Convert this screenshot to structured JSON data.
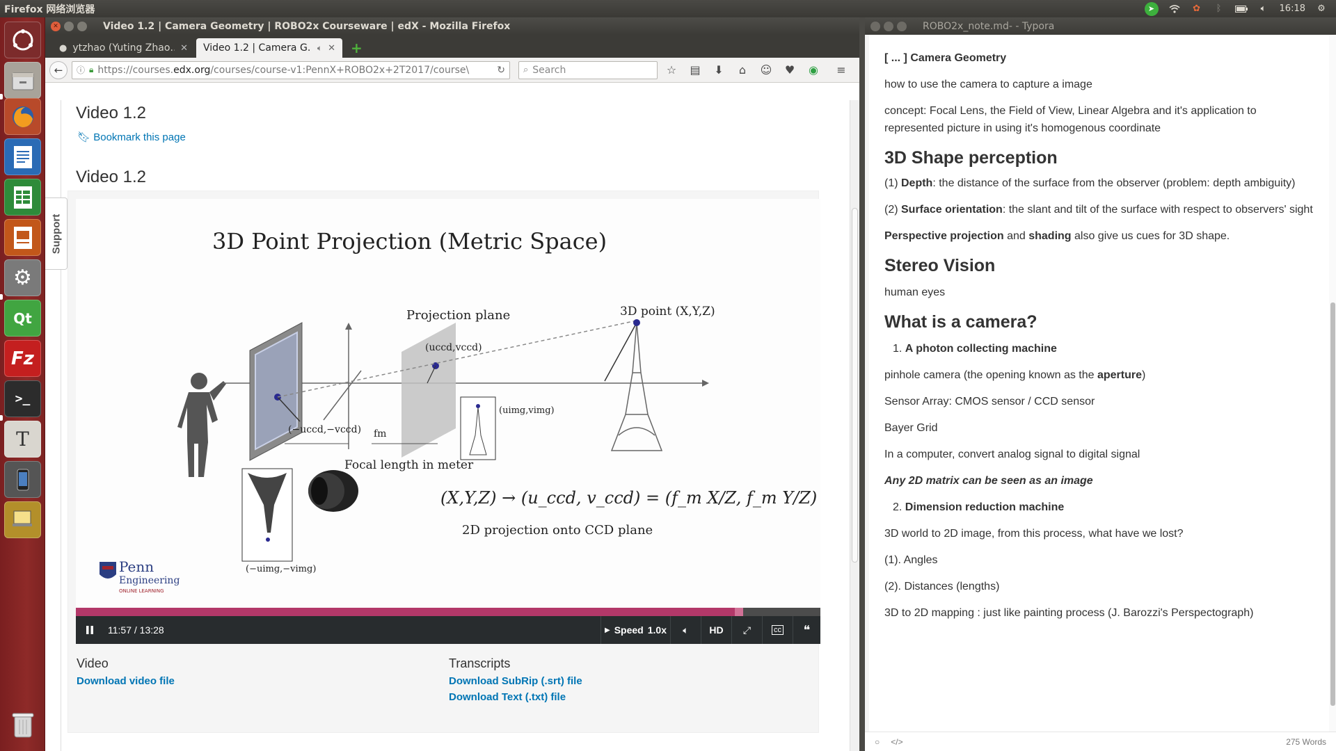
{
  "topbar": {
    "app_name": "Firefox 网络浏览器",
    "clock": "16:18"
  },
  "firefox": {
    "window_title": "Video 1.2 | Camera Geometry | ROBO2x Courseware | edX - Mozilla Firefox",
    "tabs": [
      {
        "label": "ytzhao (Yuting Zhao…"
      },
      {
        "label": "Video 1.2 | Camera G…"
      }
    ],
    "url_prefix": "https://courses.",
    "url_domain": "edx.org",
    "url_rest": "/courses/course-v1:PennX+ROBO2x+2T2017/course\\",
    "search_placeholder": "Search"
  },
  "page": {
    "support_label": "Support",
    "unit_title": "Video 1.2",
    "bookmark_label": "Bookmark this page",
    "video_heading": "Video 1.2",
    "slide": {
      "title": "3D Point Projection (Metric Space)",
      "projection_plane": "Projection plane",
      "point_label": "3D point (X,Y,Z)",
      "focal_label": "Focal length in meter",
      "formula": "(X,Y,Z) → (u_ccd, v_ccd) = (f_m X/Z, f_m Y/Z)",
      "caption": "2D projection onto CCD plane",
      "penn_1": "Penn",
      "penn_2": "Engineering",
      "penn_3": "ONLINE LEARNING",
      "label_uv_ccd": "(uccd,vccd)",
      "label_neg_uv_ccd": "(−uccd,−vccd)",
      "label_uv_img": "(uimg,vimg)",
      "label_neg_uv_img": "(−uimg,−vimg)",
      "label_fm": "fm"
    },
    "player": {
      "progress": 0.891,
      "time": "11:57 / 13:28",
      "speed_label": "Speed",
      "speed_value": "1.0x",
      "hd_label": "HD"
    },
    "downloads": {
      "video_heading": "Video",
      "video_link": "Download video file",
      "transcripts_heading": "Transcripts",
      "srt_link": "Download SubRip (.srt) file",
      "txt_link": "Download Text (.txt) file"
    }
  },
  "typora": {
    "window_title": "ROBO2x_note.md- - Typora",
    "word_count": "275 Words",
    "blocks": {
      "h_camera_geometry": "[ ... ] Camera Geometry",
      "p1": "how to use the camera to capture a image",
      "p2": "concept: Focal Lens, the Field of View, Linear Algebra and it's application to represented picture in using it's homogenous coordinate",
      "h_3d_shape": "3D Shape perception",
      "depth_prefix": "(1) ",
      "depth_bold": "Depth",
      "depth_rest": ": the distance of the surface from the observer (problem: depth ambiguity)",
      "orient_prefix": "(2) ",
      "orient_bold": "Surface orientation",
      "orient_rest": ": the slant and tilt of the surface with respect to observers' sight",
      "persp_bold": "Perspective projection",
      "persp_mid": " and ",
      "shading_bold": "shading",
      "persp_rest": " also give us cues for 3D shape.",
      "h_stereo": "Stereo Vision",
      "p_human_eyes": "human eyes",
      "h_camera": "What is a camera?",
      "li1_num": "1.",
      "li1": "A photon collecting machine",
      "pinhole_pre": "pinhole camera  (the opening known as the ",
      "pinhole_bold": "aperture",
      "pinhole_post": ")",
      "sensor": "Sensor Array: CMOS sensor / CCD sensor",
      "bayer": "Bayer Grid",
      "convert": "In a computer, convert analog signal to digital signal",
      "matrix": "Any 2D matrix can be seen as an image",
      "li2_num": "2.",
      "li2": "Dimension reduction machine",
      "lost": "3D world to 2D image, from this process, what have we lost?",
      "angles": "(1). Angles",
      "distances": "(2). Distances  (lengths)",
      "mapping": "3D to 2D mapping : just like painting process (J. Barozzi's Perspectograph)"
    }
  }
}
